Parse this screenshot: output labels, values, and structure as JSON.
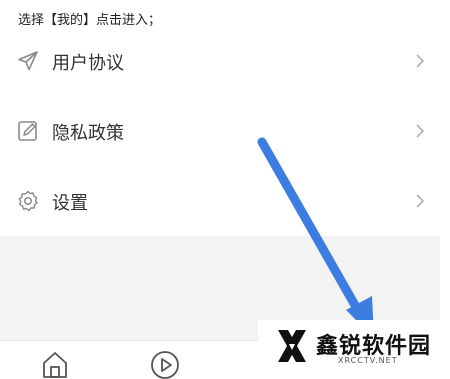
{
  "caption": "选择【我的】点击进入；",
  "menu": {
    "items": [
      {
        "label": "用户协议",
        "icon": "send-icon"
      },
      {
        "label": "隐私政策",
        "icon": "edit-icon"
      },
      {
        "label": "设置",
        "icon": "gear-icon"
      }
    ]
  },
  "bottom_tabs": [
    {
      "icon": "home-icon"
    },
    {
      "icon": "play-icon"
    }
  ],
  "watermark": {
    "title": "鑫锐软件园",
    "subtitle": "XRCCTV.NET"
  },
  "colors": {
    "arrow": "#3b7de0",
    "background_gray": "#f3f3f3",
    "icon_gray": "#8a8a8a"
  }
}
